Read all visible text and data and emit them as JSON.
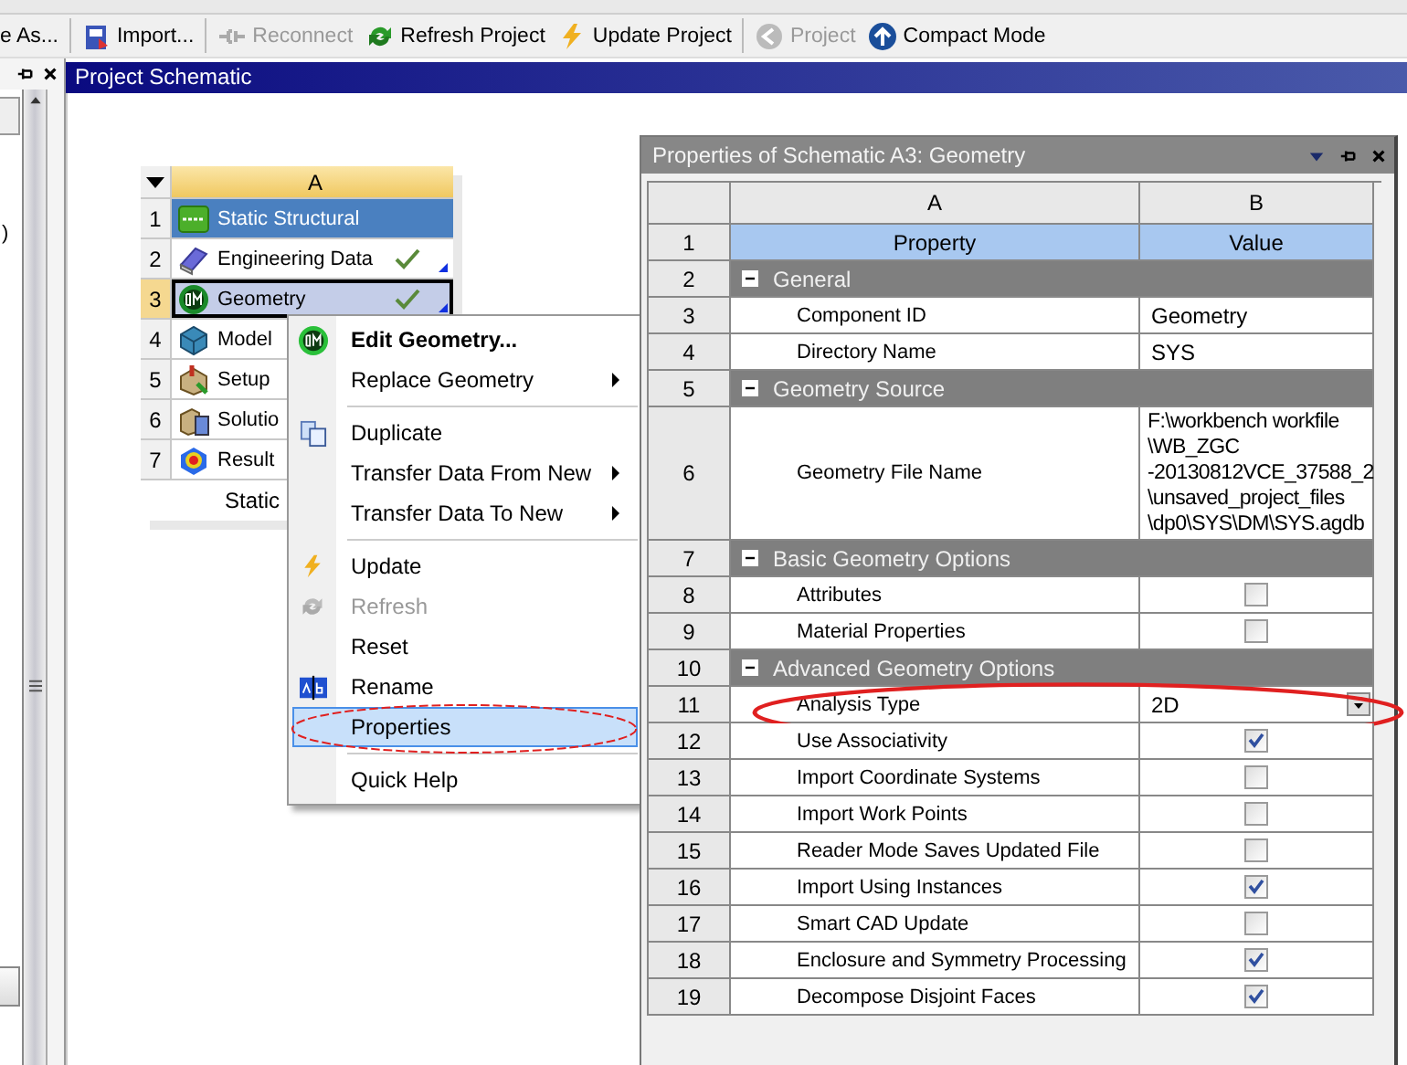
{
  "toolbar": [
    {
      "label": "e As...",
      "kind": "plain",
      "disabled": false
    },
    {
      "label": "Import...",
      "kind": "import",
      "disabled": false
    },
    {
      "label": "Reconnect",
      "kind": "reconnect",
      "disabled": true
    },
    {
      "label": "Refresh Project",
      "kind": "refresh",
      "disabled": false
    },
    {
      "label": "Update Project",
      "kind": "update",
      "disabled": false
    },
    {
      "label": "Project",
      "kind": "back",
      "disabled": true
    },
    {
      "label": "Compact Mode",
      "kind": "compact",
      "disabled": false
    }
  ],
  "left_panel": {
    "fragment": ")"
  },
  "schematic": {
    "title": "Project Schematic",
    "column": "A",
    "system_name": "Static",
    "rows": [
      {
        "number": "1",
        "label": "Static Structural",
        "kind": "system",
        "selected": false,
        "up_to_date": false
      },
      {
        "number": "2",
        "label": "Engineering Data",
        "kind": "book",
        "selected": false,
        "up_to_date": true
      },
      {
        "number": "3",
        "label": "Geometry",
        "kind": "dm",
        "selected": true,
        "up_to_date": true
      },
      {
        "number": "4",
        "label": "Model",
        "kind": "mesh",
        "selected": false,
        "up_to_date": false
      },
      {
        "number": "5",
        "label": "Setup",
        "kind": "setup",
        "selected": false,
        "up_to_date": false
      },
      {
        "number": "6",
        "label": "Solutio",
        "kind": "solution",
        "selected": false,
        "up_to_date": false
      },
      {
        "number": "7",
        "label": "Result",
        "kind": "result",
        "selected": false,
        "up_to_date": false
      }
    ]
  },
  "context_menu": [
    {
      "kind": "dm",
      "label": "Edit Geometry...",
      "bold": true,
      "submenu": false,
      "disabled": false,
      "selected": false
    },
    {
      "kind": "plain",
      "label": "Replace Geometry",
      "bold": false,
      "submenu": true,
      "disabled": false,
      "selected": false
    },
    {
      "kind": "separator"
    },
    {
      "kind": "copy",
      "label": "Duplicate",
      "bold": false,
      "submenu": false,
      "disabled": false,
      "selected": false
    },
    {
      "kind": "plain",
      "label": "Transfer Data From New",
      "bold": false,
      "submenu": true,
      "disabled": false,
      "selected": false
    },
    {
      "kind": "plain",
      "label": "Transfer Data To New",
      "bold": false,
      "submenu": true,
      "disabled": false,
      "selected": false
    },
    {
      "kind": "separator"
    },
    {
      "kind": "bolt",
      "label": "Update",
      "bold": false,
      "submenu": false,
      "disabled": false,
      "selected": false
    },
    {
      "kind": "refresh",
      "label": "Refresh",
      "bold": false,
      "submenu": false,
      "disabled": true,
      "selected": false
    },
    {
      "kind": "plain",
      "label": "Reset",
      "bold": false,
      "submenu": false,
      "disabled": false,
      "selected": false
    },
    {
      "kind": "rename",
      "label": "Rename",
      "bold": false,
      "submenu": false,
      "disabled": false,
      "selected": false
    },
    {
      "kind": "plain",
      "label": "Properties",
      "bold": false,
      "submenu": false,
      "disabled": false,
      "selected": true
    },
    {
      "kind": "separator"
    },
    {
      "kind": "plain",
      "label": "Quick Help",
      "bold": false,
      "submenu": false,
      "disabled": false,
      "selected": false
    }
  ],
  "properties": {
    "title": "Properties of Schematic A3: Geometry",
    "columns": [
      "A",
      "B"
    ],
    "rows": [
      {
        "number": "1",
        "kind": "heading",
        "property": "Property",
        "value": "Value"
      },
      {
        "number": "2",
        "kind": "group",
        "label": "General",
        "expanded": true
      },
      {
        "number": "3",
        "kind": "text",
        "property": "Component ID",
        "value": [
          "Geometry"
        ]
      },
      {
        "number": "4",
        "kind": "text",
        "property": "Directory Name",
        "value": [
          "SYS"
        ]
      },
      {
        "number": "5",
        "kind": "group",
        "label": "Geometry Source",
        "expanded": true
      },
      {
        "number": "6",
        "kind": "text",
        "property": "Geometry File Name",
        "value": [
          "F:\\workbench workfile",
          "\\WB_ZGC",
          "-20130812VCE_37588_2",
          "\\unsaved_project_files",
          "\\dp0\\SYS\\DM\\SYS.agdb"
        ]
      },
      {
        "number": "7",
        "kind": "group",
        "label": "Basic Geometry Options",
        "expanded": true
      },
      {
        "number": "8",
        "kind": "check",
        "property": "Attributes",
        "checked": false
      },
      {
        "number": "9",
        "kind": "check",
        "property": "Material Properties",
        "checked": false
      },
      {
        "number": "10",
        "kind": "group",
        "label": "Advanced Geometry Options",
        "expanded": true
      },
      {
        "number": "11",
        "kind": "dropdown",
        "property": "Analysis Type",
        "value": "2D"
      },
      {
        "number": "12",
        "kind": "check",
        "property": "Use Associativity",
        "checked": true
      },
      {
        "number": "13",
        "kind": "check",
        "property": "Import Coordinate Systems",
        "checked": false
      },
      {
        "number": "14",
        "kind": "check",
        "property": "Import Work Points",
        "checked": false
      },
      {
        "number": "15",
        "kind": "check",
        "property": "Reader Mode Saves Updated File",
        "checked": false
      },
      {
        "number": "16",
        "kind": "check",
        "property": "Import Using Instances",
        "checked": true
      },
      {
        "number": "17",
        "kind": "check",
        "property": "Smart CAD Update",
        "checked": false
      },
      {
        "number": "18",
        "kind": "check",
        "property": "Enclosure and Symmetry Processing",
        "checked": true
      },
      {
        "number": "19",
        "kind": "check",
        "property": "Decompose Disjoint Faces",
        "checked": true
      }
    ]
  }
}
